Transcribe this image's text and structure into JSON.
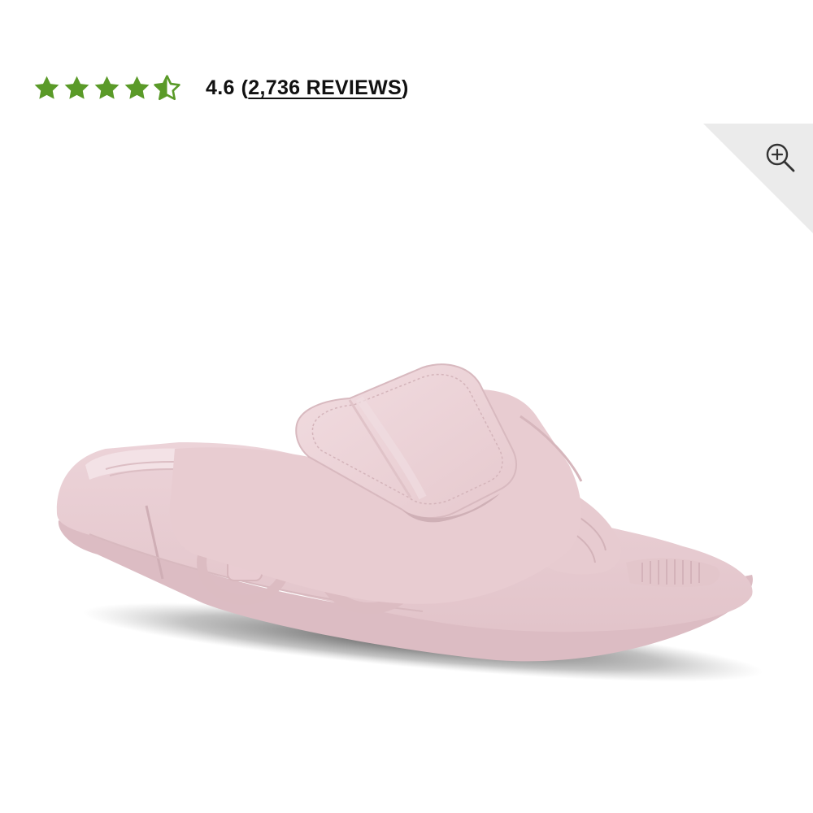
{
  "rating": {
    "value": "4.6",
    "stars_filled": 4.6,
    "stars_total": 5,
    "star_color": "#5a9a28",
    "reviews_open": "(",
    "reviews_label": "2,736 REVIEWS",
    "reviews_close": ")"
  },
  "product_image": {
    "subject": "pink adjustable strap slide sandal",
    "color": "#ecd2d6"
  },
  "zoom": {
    "icon": "zoom-in-icon"
  }
}
